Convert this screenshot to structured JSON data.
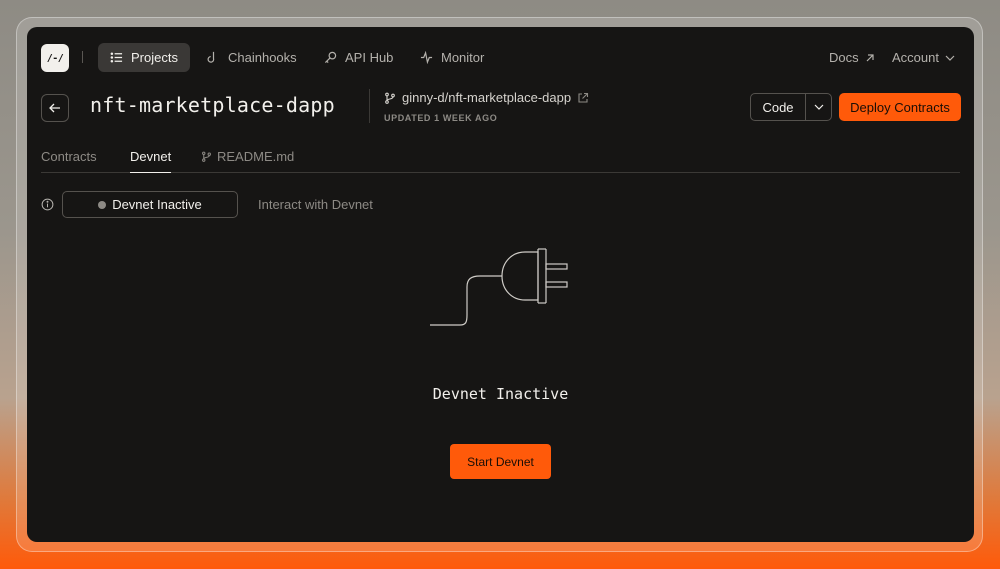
{
  "nav": {
    "logo_text": "/-/",
    "items": [
      {
        "label": "Projects",
        "icon": "list-icon",
        "active": true
      },
      {
        "label": "Chainhooks",
        "icon": "hook-icon",
        "active": false
      },
      {
        "label": "API Hub",
        "icon": "key-icon",
        "active": false
      },
      {
        "label": "Monitor",
        "icon": "activity-icon",
        "active": false
      }
    ],
    "docs_label": "Docs",
    "account_label": "Account"
  },
  "project": {
    "title": "nft-marketplace-dapp",
    "repo": "ginny-d/nft-marketplace-dapp",
    "updated": "UPDATED 1 WEEK AGO"
  },
  "actions": {
    "code_label": "Code",
    "deploy_label": "Deploy Contracts"
  },
  "tabs": [
    {
      "label": "Contracts",
      "active": false
    },
    {
      "label": "Devnet",
      "active": true
    },
    {
      "label": "README.md",
      "active": false
    }
  ],
  "devnet": {
    "status_label": "Devnet Inactive",
    "interact_label": "Interact with Devnet",
    "empty_title": "Devnet Inactive",
    "start_label": "Start Devnet"
  },
  "colors": {
    "accent": "#ff5a0a",
    "background": "#161514",
    "status_inactive": "#8d8a85"
  }
}
